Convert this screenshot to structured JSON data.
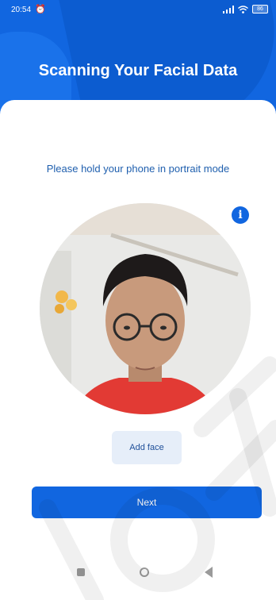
{
  "status_bar": {
    "time": "20:54",
    "battery": "86"
  },
  "header": {
    "title": "Scanning Your Facial Data"
  },
  "main": {
    "instruction": "Please hold your phone in portrait mode",
    "info_icon_glyph": "i",
    "add_face_label": "Add face",
    "next_label": "Next"
  },
  "colors": {
    "primary": "#1166e0",
    "instruction_text": "#1f5fae",
    "add_face_bg": "#e6eef9"
  },
  "icons": [
    "alarm-icon",
    "signal-icon",
    "wifi-icon",
    "battery-icon",
    "info-icon",
    "nav-recents-icon",
    "nav-home-icon",
    "nav-back-icon"
  ]
}
